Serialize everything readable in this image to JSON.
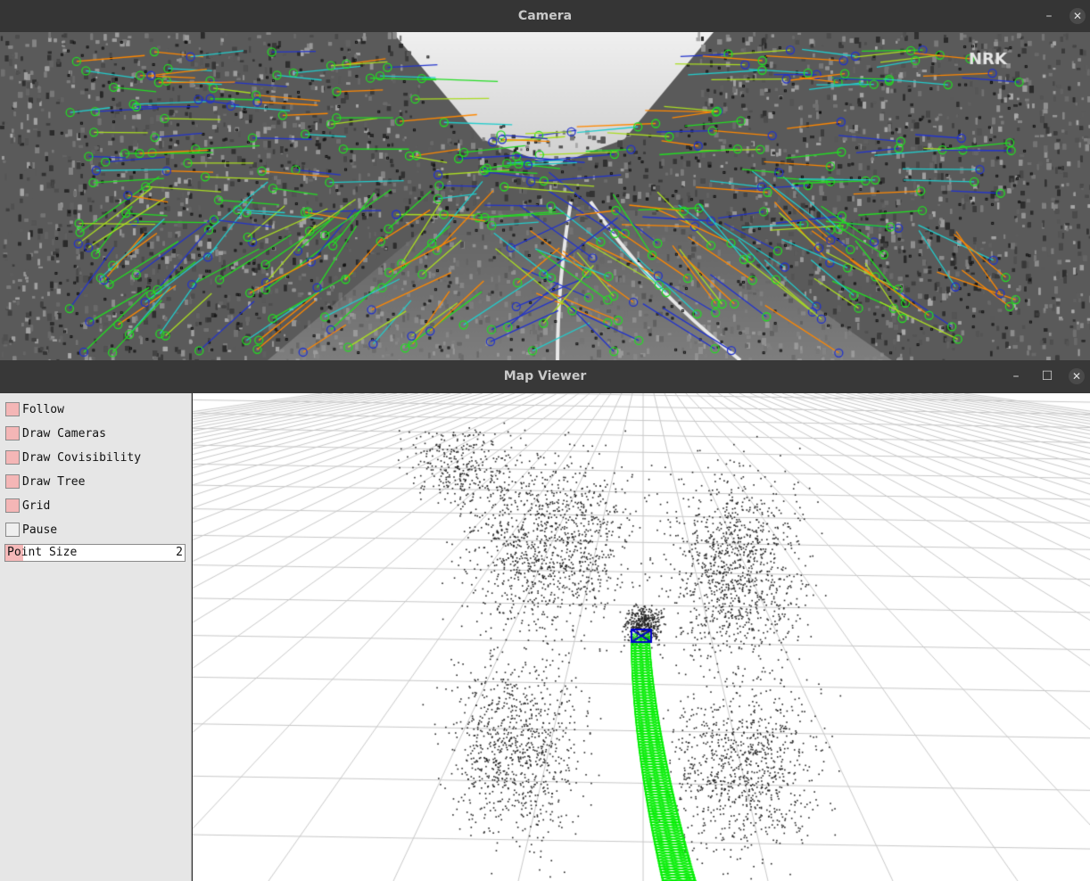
{
  "camera_window": {
    "title": "Camera",
    "minimize_label": "–",
    "close_label": "✕",
    "watermark": "NRK",
    "feature_colors": [
      "#22dd22",
      "#2233cc",
      "#22cccc",
      "#aadd22",
      "#ff8800"
    ]
  },
  "map_window": {
    "title": "Map Viewer",
    "minimize_label": "–",
    "maximize_label": "☐",
    "close_label": "✕",
    "panel": {
      "checkboxes": [
        {
          "label": "Follow",
          "checked": true
        },
        {
          "label": "Draw Cameras",
          "checked": true
        },
        {
          "label": "Draw Covisibility",
          "checked": true
        },
        {
          "label": "Draw Tree",
          "checked": true
        },
        {
          "label": "Grid",
          "checked": true
        },
        {
          "label": "Pause",
          "checked": false
        }
      ],
      "point_size": {
        "label": "Point Size",
        "value": "2",
        "fraction": 0.1
      }
    },
    "colors": {
      "trajectory": "#00ee00",
      "current_camera": "#0000cc",
      "grid": "#c8c8c8",
      "points": "#222222"
    }
  }
}
